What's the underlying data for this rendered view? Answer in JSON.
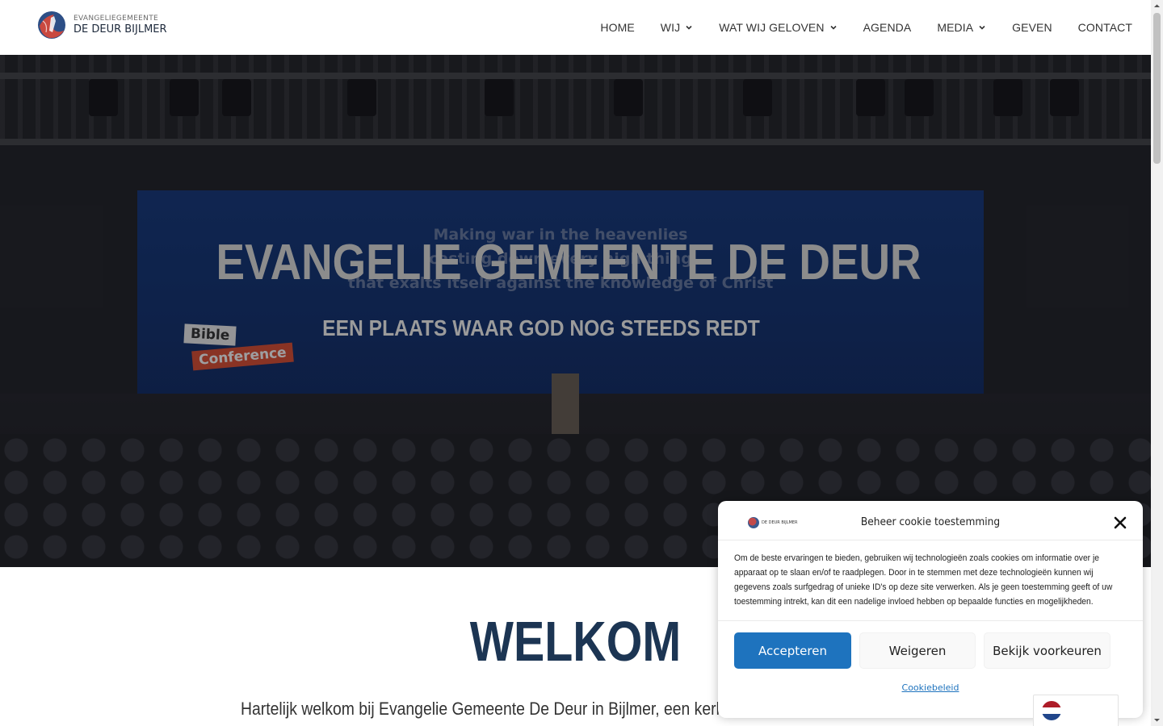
{
  "header": {
    "logo": {
      "line1": "EVANGELIEGEMEENTE",
      "line2": "DE DEUR BIJLMER"
    },
    "nav": [
      {
        "label": "HOME",
        "dropdown": false
      },
      {
        "label": "WIJ",
        "dropdown": true
      },
      {
        "label": "WAT WIJ GELOVEN",
        "dropdown": true
      },
      {
        "label": "AGENDA",
        "dropdown": false
      },
      {
        "label": "MEDIA",
        "dropdown": true
      },
      {
        "label": "GEVEN",
        "dropdown": false
      },
      {
        "label": "CONTACT",
        "dropdown": false
      }
    ]
  },
  "hero": {
    "title": "EVANGELIE GEMEENTE DE DEUR",
    "subtitle": "EEN PLAATS WAAR GOD NOG STEEDS REDT",
    "photo": {
      "screen_text": "Making war in the heavenlies\ncasting down every high thing\nthat exalts itself against the knowledge of Christ",
      "sign_bible": "Bible",
      "sign_conference": "Conference"
    }
  },
  "welcome": {
    "title": "WELKOM",
    "text": "Hartelijk welkom bij Evangelie Gemeente De Deur in Bijlmer, een kerk w"
  },
  "cookie": {
    "logo_text": "DE DEUR BIJLMER",
    "title": "Beheer cookie toestemming",
    "body": "Om de beste ervaringen te bieden, gebruiken wij technologieën zoals cookies om informatie over je apparaat op te slaan en/of te raadplegen. Door in te stemmen met deze technologieën kunnen wij gegevens zoals surfgedrag of unieke ID's op deze site verwerken. Als je geen toestemming geeft of uw toestemming intrekt, kan dit een nadelige invloed hebben op bepaalde functies en mogelijkheden.",
    "accept": "Accepteren",
    "deny": "Weigeren",
    "preferences": "Bekijk voorkeuren",
    "policy_link": "Cookiebeleid"
  },
  "language": {
    "flag": "netherlands-flag",
    "colors": [
      "#ae1c28",
      "#ffffff",
      "#21468b"
    ]
  },
  "colors": {
    "accent": "#1e73be",
    "heading": "#1c3553",
    "hero_overlay": "#141419"
  }
}
